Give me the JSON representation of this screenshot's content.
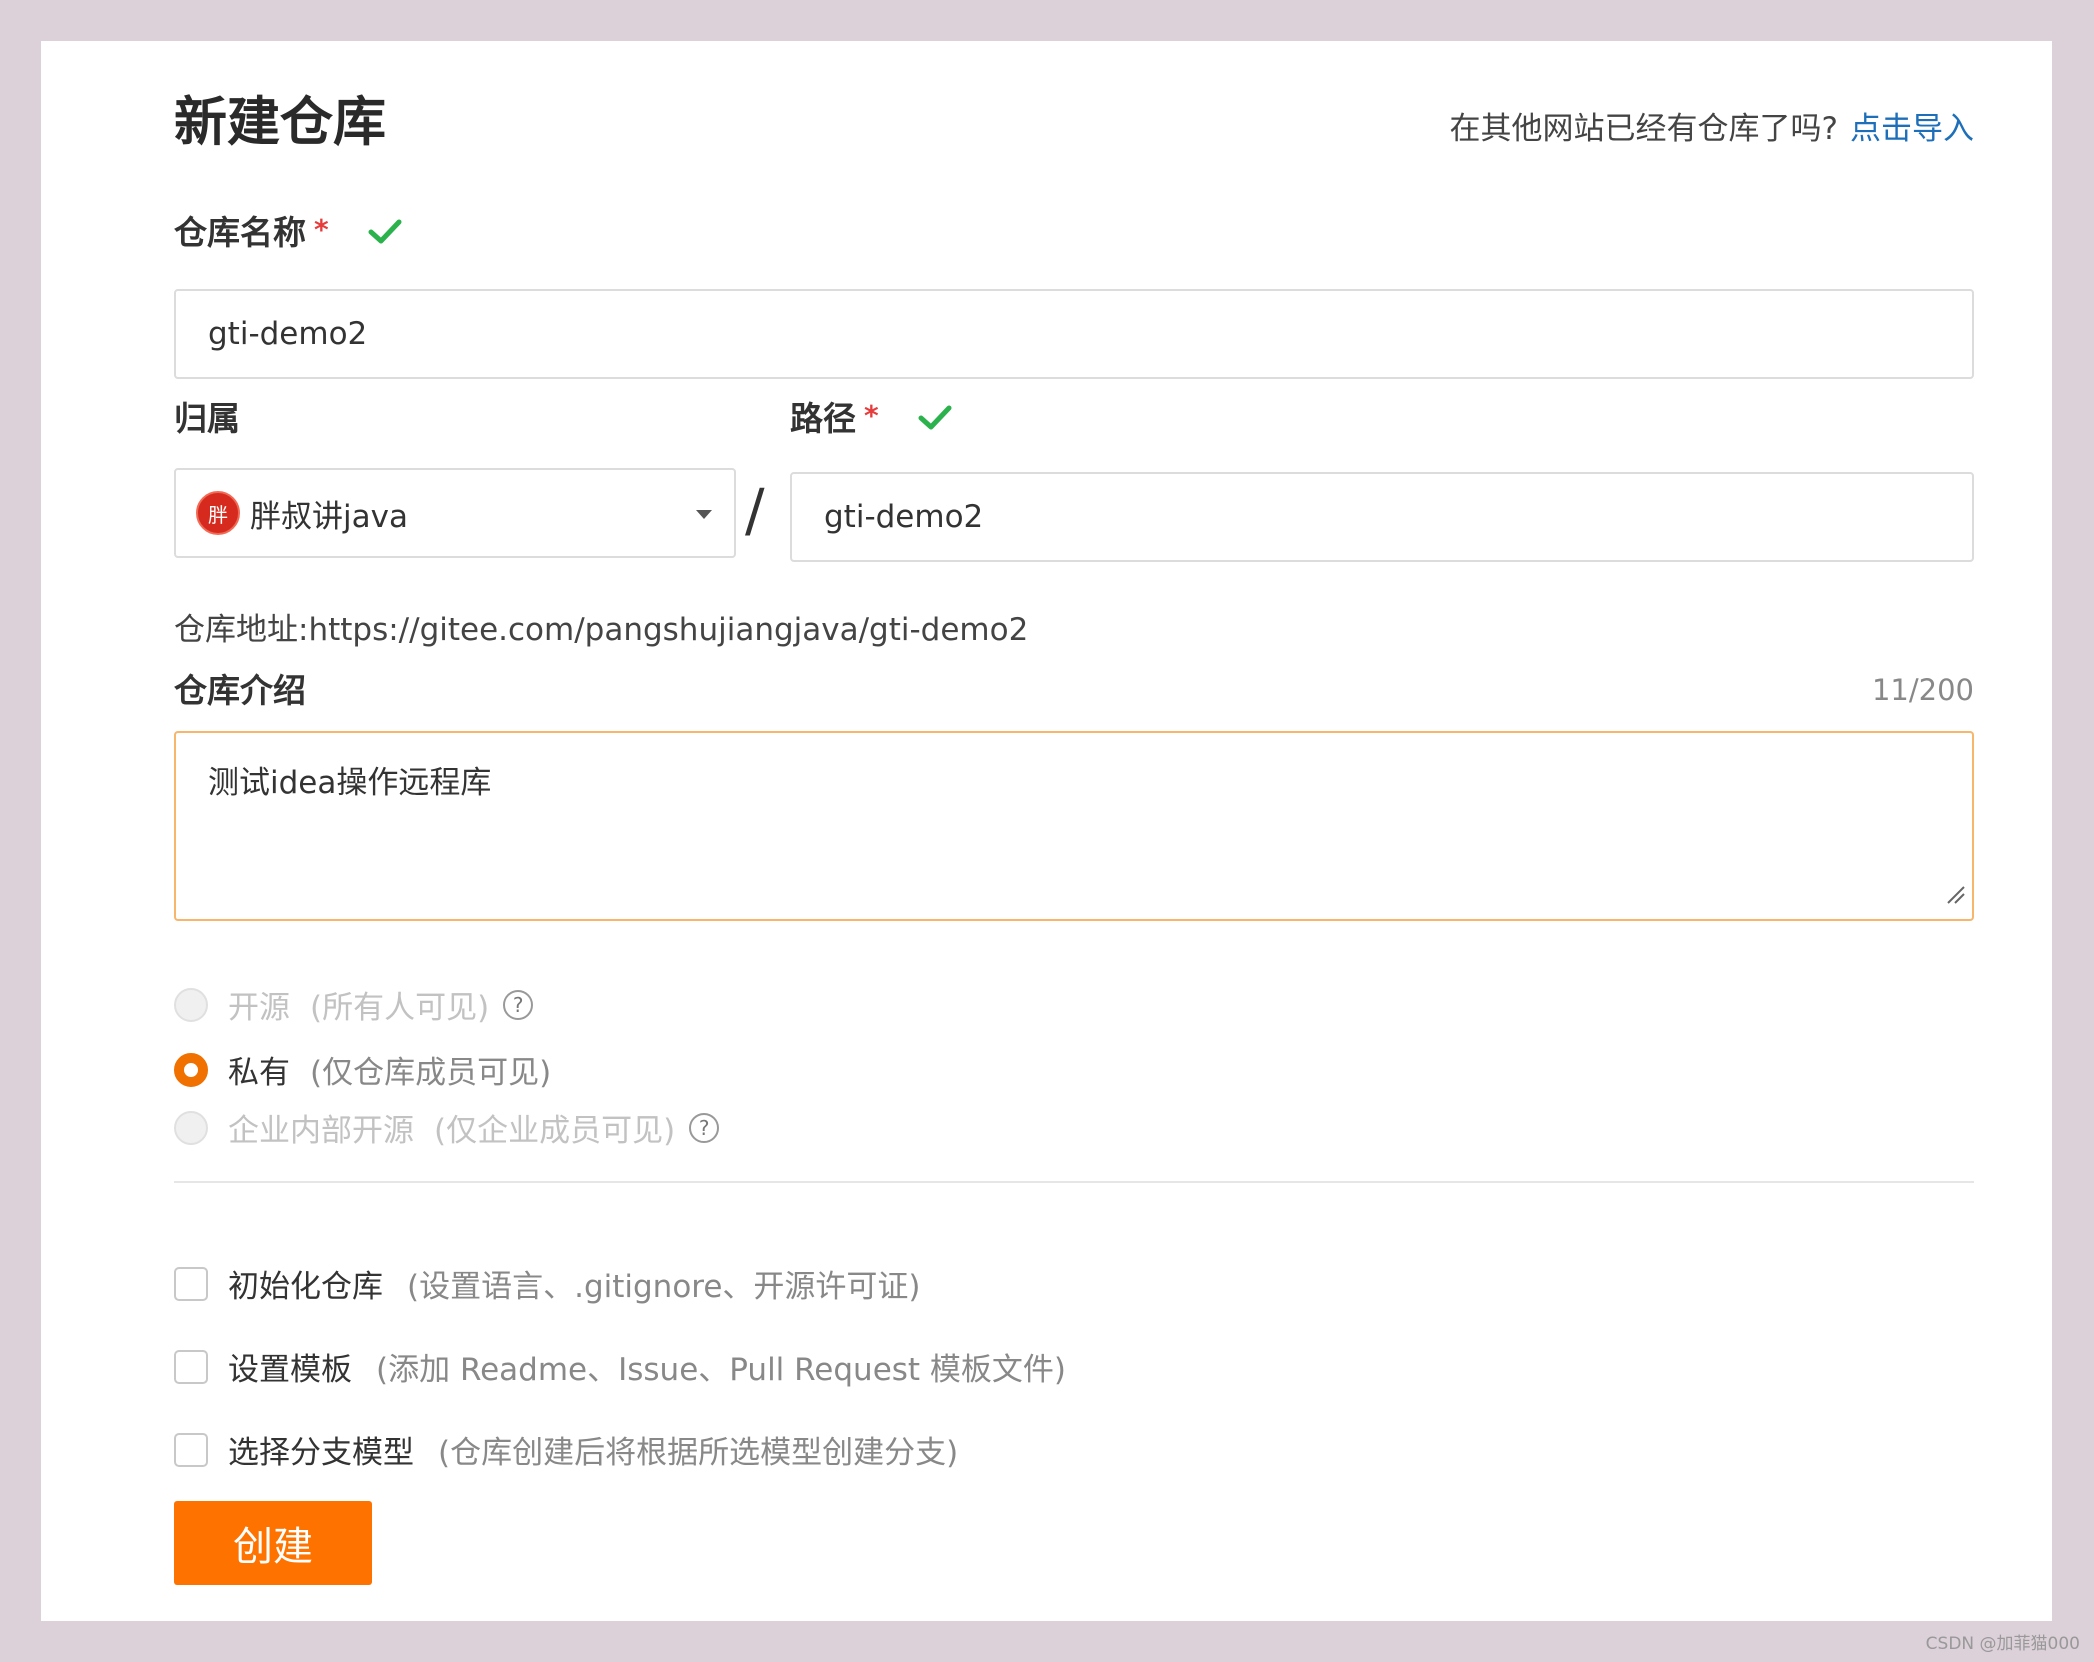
{
  "header": {
    "title": "新建仓库",
    "import_prompt": "在其他网站已经有仓库了吗?",
    "import_link": "点击导入"
  },
  "form": {
    "repo_name": {
      "label": "仓库名称",
      "required_mark": "*",
      "value": "gti-demo2"
    },
    "owner": {
      "label": "归属",
      "avatar_text": "胖",
      "value": "胖叔讲java"
    },
    "separator": "/",
    "path": {
      "label": "路径",
      "required_mark": "*",
      "value": "gti-demo2"
    },
    "repo_url": "仓库地址:https://gitee.com/pangshujiangjava/gti-demo2",
    "description": {
      "label": "仓库介绍",
      "counter": "11/200",
      "value": "测试idea操作远程库"
    },
    "visibility": [
      {
        "label": "开源",
        "hint": "(所有人可见)",
        "help": "?",
        "state": "disabled"
      },
      {
        "label": "私有",
        "hint": "(仅仓库成员可见)",
        "state": "checked"
      },
      {
        "label": "企业内部开源",
        "hint": "(仅企业成员可见)",
        "help": "?",
        "state": "disabled"
      }
    ],
    "options": [
      {
        "label": "初始化仓库",
        "hint": "(设置语言、.gitignore、开源许可证)",
        "checked": false
      },
      {
        "label": "设置模板",
        "hint": "(添加 Readme、Issue、Pull Request 模板文件)",
        "checked": false
      },
      {
        "label": "选择分支模型",
        "hint": "(仓库创建后将根据所选模型创建分支)",
        "checked": false
      }
    ],
    "submit_label": "创建"
  },
  "watermark": "CSDN @加菲猫000",
  "colors": {
    "accent": "#fe7300",
    "link": "#1e6fba",
    "check": "#2bb24c",
    "required": "#e63c3c"
  }
}
